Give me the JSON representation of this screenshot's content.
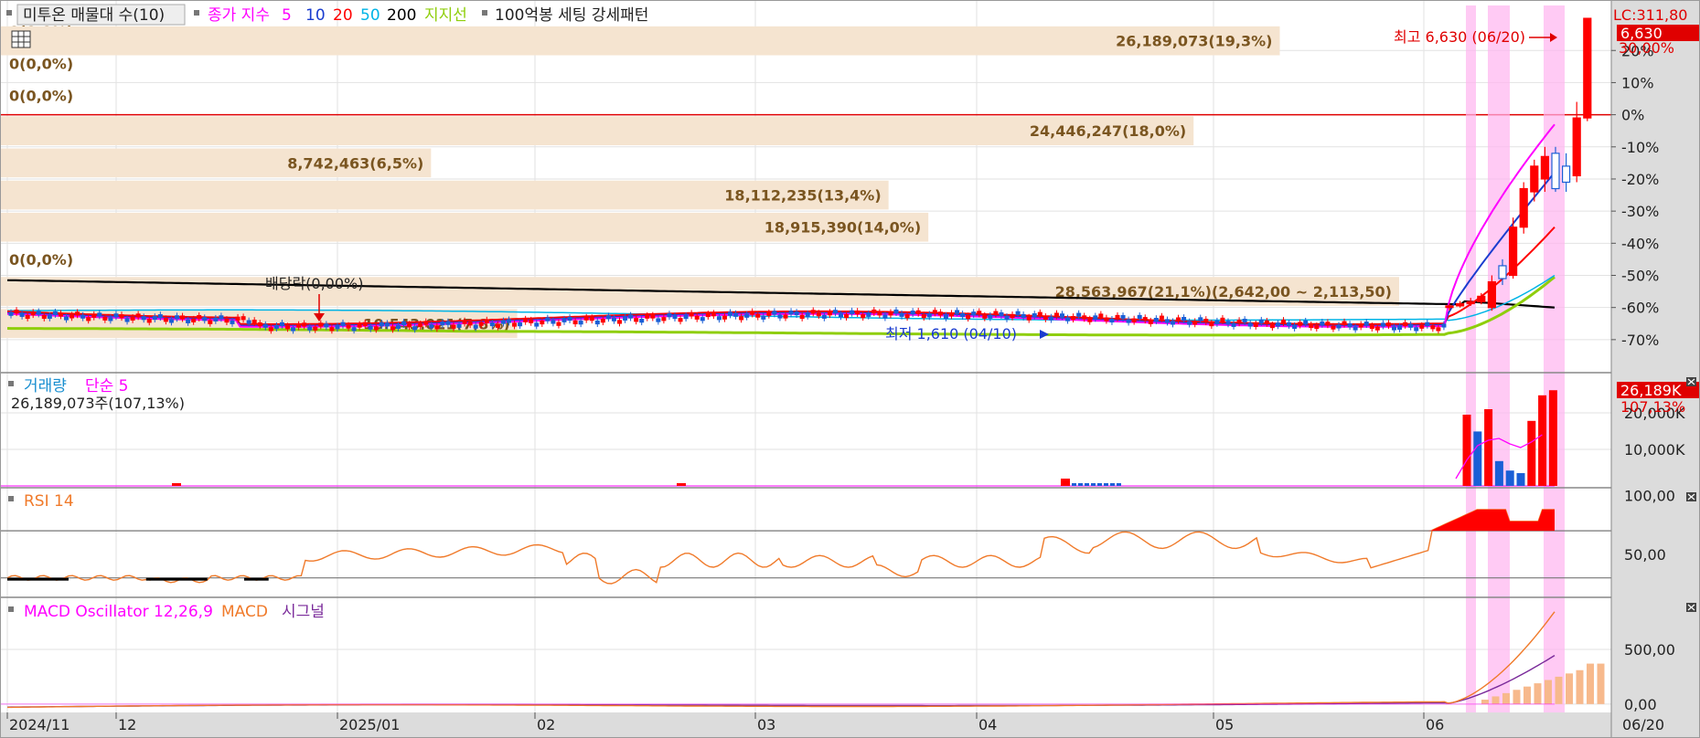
{
  "chart_data": [
    {
      "type": "candlestick",
      "legend": {
        "title": "미투온 매물대 수(10)",
        "ma_label": "종가 지수",
        "ma_periods": [
          {
            "label": "5",
            "color": "#ff00ff"
          },
          {
            "label": "10",
            "color": "#1a3ccf"
          },
          {
            "label": "20",
            "color": "#ff0000"
          },
          {
            "label": "50",
            "color": "#00b4e6"
          },
          {
            "label": "200",
            "color": "#000000"
          }
        ],
        "support_label": "지지선",
        "support_color": "#8fce0c",
        "pattern_label": "100억봉 세팅 강세패턴"
      },
      "lc_label": "LC:311,80",
      "price_tag": "6,630",
      "pct_tag": "30,00%",
      "y_ticks": [
        "20%",
        "10%",
        "0%",
        "-10%",
        "-20%",
        "-30%",
        "-40%",
        "-50%",
        "-60%",
        "-70%"
      ],
      "y_range_pct": [
        -78,
        34
      ],
      "high_note": "최고 6,630 (06/20)",
      "low_note": "최저 1,610 (04/10)",
      "dividend_note": "배당락(0,00%)",
      "volume_profile": [
        {
          "label": "0(0,0%)",
          "pct": 26,
          "share": 0
        },
        {
          "label": "26,189,073(19,3%)",
          "pct": 23,
          "share": 19.3
        },
        {
          "label": "0(0,0%)",
          "pct": 16,
          "share": 0
        },
        {
          "label": "0(0,0%)",
          "pct": 6,
          "share": 0
        },
        {
          "label": "24,446,247(18,0%)",
          "pct": -5,
          "share": 18.0
        },
        {
          "label": "8,742,463(6,5%)",
          "pct": -15,
          "share": 6.5
        },
        {
          "label": "18,112,235(13,4%)",
          "pct": -25,
          "share": 13.4
        },
        {
          "label": "18,915,390(14,0%)",
          "pct": -35,
          "share": 14.0
        },
        {
          "label": "0(0,0%)",
          "pct": -45,
          "share": 0
        },
        {
          "label": "28,563,967(21,1%)(2,642,00 ~ 2,113,50)",
          "pct": -55,
          "share": 21.1
        },
        {
          "label": "10,543,021(7,8%)",
          "pct": -65,
          "share": 7.8
        }
      ],
      "recent_candles_pct": [
        {
          "date": "06/02",
          "o": -60,
          "h": -58.8,
          "l": -61,
          "c": -59.5
        },
        {
          "date": "06/03",
          "o": -59.5,
          "h": -58,
          "l": -60,
          "c": -58.8
        },
        {
          "date": "06/04",
          "o": -58.8,
          "h": -57,
          "l": -59.5,
          "c": -58.2
        },
        {
          "date": "06/05",
          "o": -58.2,
          "h": -55.5,
          "l": -59,
          "c": -56.5
        },
        {
          "date": "06/06",
          "o": -60,
          "h": -50,
          "l": -61,
          "c": -52
        },
        {
          "date": "06/09",
          "o": -47,
          "h": -45,
          "l": -53,
          "c": -51
        },
        {
          "date": "06/10",
          "o": -50,
          "h": -32,
          "l": -51,
          "c": -35
        },
        {
          "date": "06/11",
          "o": -35,
          "h": -21,
          "l": -37,
          "c": -23
        },
        {
          "date": "06/12",
          "o": -24,
          "h": -14,
          "l": -27,
          "c": -16
        },
        {
          "date": "06/13",
          "o": -20,
          "h": -10,
          "l": -24,
          "c": -13
        },
        {
          "date": "06/16",
          "o": -12,
          "h": -10,
          "l": -24,
          "c": -23
        },
        {
          "date": "06/17",
          "o": -16,
          "h": -12,
          "l": -24,
          "c": -21
        },
        {
          "date": "06/18",
          "o": -19,
          "h": 4,
          "l": -21,
          "c": -1
        },
        {
          "date": "06/19",
          "o": -1,
          "h": 30,
          "l": -2,
          "c": 30
        }
      ]
    },
    {
      "type": "bar",
      "legend": [
        "거래량",
        "단순 5"
      ],
      "sub_label": "26,189,073주(107,13%)",
      "value_tag": "26,189K",
      "pct_tag": "107,13%",
      "y_ticks": [
        "20,000K",
        "10,000K"
      ],
      "recent_volume_k": [
        {
          "date": "06/09",
          "value": 19500,
          "up": true
        },
        {
          "date": "06/10",
          "value": 14900,
          "up": false
        },
        {
          "date": "06/11",
          "value": 21000,
          "up": true
        },
        {
          "date": "06/12",
          "value": 6800,
          "up": false
        },
        {
          "date": "06/13",
          "value": 4200,
          "up": false
        },
        {
          "date": "06/16",
          "value": 3500,
          "up": false
        },
        {
          "date": "06/17",
          "value": 17800,
          "up": true
        },
        {
          "date": "06/18",
          "value": 24800,
          "up": true
        },
        {
          "date": "06/19",
          "value": 26189,
          "up": true
        }
      ]
    },
    {
      "type": "line",
      "legend": "RSI 14",
      "y_ticks": [
        "100,00",
        "50,00"
      ],
      "levels": [
        70,
        30
      ]
    },
    {
      "type": "line",
      "legend": [
        "MACD Oscillator 12,26,9",
        "MACD",
        "시그널"
      ],
      "y_ticks": [
        "500,00",
        "0,00"
      ]
    }
  ],
  "x_axis": {
    "ticks": [
      "2024/11",
      "12",
      "2025/01",
      "02",
      "03",
      "04",
      "05",
      "06"
    ],
    "cursor_label": "06/20"
  },
  "colors": {
    "up": "#ff0000",
    "down": "#1a5fd6",
    "profile": "#f5e4d0",
    "profile_text": "#7a5520",
    "highlight": "#ffb3f0",
    "rsi": "#f07a2a",
    "macd": "#f07a2a",
    "signal": "#7a2a9a",
    "oscillator": "#ff00ff"
  }
}
